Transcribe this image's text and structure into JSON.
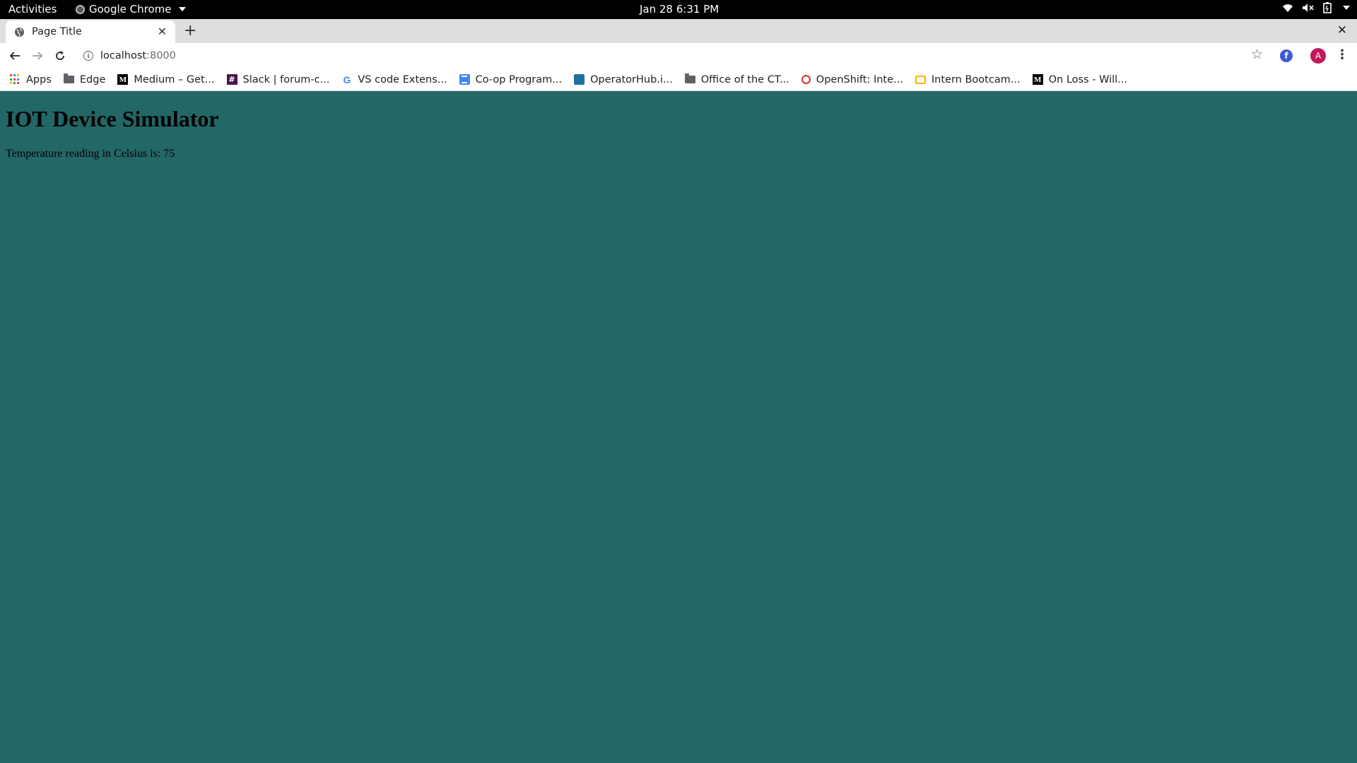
{
  "system_bar": {
    "activities": "Activities",
    "app_name": "Google Chrome",
    "clock": "Jan 28   6:31 PM"
  },
  "browser": {
    "tab_title": "Page Title",
    "new_tab": "+",
    "close_window": "✕",
    "url_host": "localhost",
    "url_port": ":8000",
    "avatar_letter": "A",
    "extension_letter": "f"
  },
  "bookmarks": [
    {
      "label": "Apps",
      "icon": "apps-grid-icon"
    },
    {
      "label": "Edge",
      "icon": "folder-icon"
    },
    {
      "label": "Medium – Get...",
      "icon": "medium-icon"
    },
    {
      "label": "Slack | forum-c...",
      "icon": "slack-icon"
    },
    {
      "label": "VS code Extens...",
      "icon": "google-icon"
    },
    {
      "label": "Co-op Program...",
      "icon": "docs-icon"
    },
    {
      "label": "OperatorHub.i...",
      "icon": "operatorhub-icon"
    },
    {
      "label": "Office of the CT...",
      "icon": "folder-icon"
    },
    {
      "label": "OpenShift: Inte...",
      "icon": "redhat-icon"
    },
    {
      "label": "Intern Bootcam...",
      "icon": "slides-icon"
    },
    {
      "label": "On Loss - Will...",
      "icon": "medium-icon"
    }
  ],
  "page": {
    "heading": "IOT Device Simulator",
    "reading": "Temperature reading in Celsius is: 75"
  },
  "colors": {
    "page_background": "#236767",
    "avatar": "#c2185b"
  }
}
